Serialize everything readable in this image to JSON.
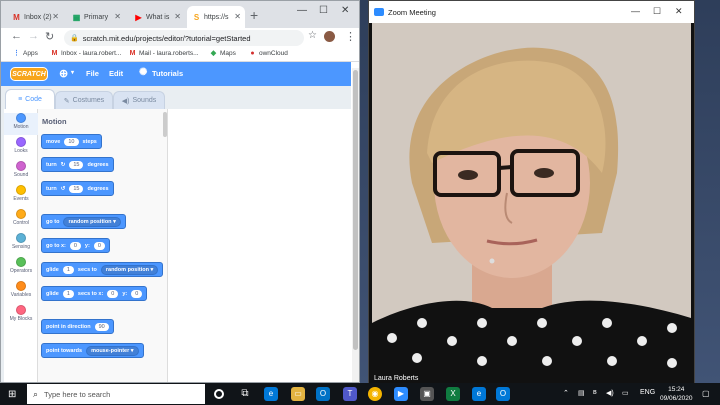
{
  "chrome": {
    "tabs": [
      {
        "icon": "gmail-icon",
        "glyph": "M",
        "color": "#d93025",
        "label": "Inbox (2)"
      },
      {
        "icon": "sheets-icon",
        "glyph": "▦",
        "color": "#0f9d58",
        "label": "Primary"
      },
      {
        "icon": "youtube-icon",
        "glyph": "▶",
        "color": "#ff0000",
        "label": "What is"
      },
      {
        "icon": "scratch-tab-icon",
        "glyph": "S",
        "color": "#f7a51c",
        "label": "https://s"
      }
    ],
    "new_tab": "+",
    "url": "scratch.mit.edu/projects/editor/?tutorial=getStarted",
    "bookmarks": [
      {
        "icon": "apps-icon",
        "glyph": "⋮",
        "color": "#4285f4",
        "label": "Apps"
      },
      {
        "icon": "gmail-icon",
        "glyph": "M",
        "color": "#d93025",
        "label": "Inbox - laura.robert..."
      },
      {
        "icon": "gmail-icon",
        "glyph": "M",
        "color": "#d93025",
        "label": "Mail - laura.roberts..."
      },
      {
        "icon": "maps-icon",
        "glyph": "◆",
        "color": "#34a853",
        "label": "Maps"
      },
      {
        "icon": "owncloud-icon",
        "glyph": "●",
        "color": "#d32f2f",
        "label": "ownCloud"
      }
    ]
  },
  "scratch": {
    "logo": "SCRATCH",
    "menu": {
      "file": "File",
      "edit": "Edit",
      "tutorials": "Tutorials"
    },
    "tabs": {
      "code": "Code",
      "costumes": "Costumes",
      "sounds": "Sounds"
    },
    "categories": [
      {
        "label": "Motion",
        "color": "#4c97ff"
      },
      {
        "label": "Looks",
        "color": "#9966ff"
      },
      {
        "label": "Sound",
        "color": "#cf63cf"
      },
      {
        "label": "Events",
        "color": "#ffbf00"
      },
      {
        "label": "Control",
        "color": "#ffab19"
      },
      {
        "label": "Sensing",
        "color": "#5cb1d6"
      },
      {
        "label": "Operators",
        "color": "#59c059"
      },
      {
        "label": "Variables",
        "color": "#ff8c1a"
      },
      {
        "label": "My Blocks",
        "color": "#ff6680"
      }
    ],
    "palette_title": "Motion",
    "blocks": {
      "move": {
        "a": "move",
        "n": "10",
        "b": "steps"
      },
      "turn_right": {
        "a": "turn",
        "n": "15",
        "b": "degrees"
      },
      "turn_left": {
        "a": "turn",
        "n": "15",
        "b": "degrees"
      },
      "goto": {
        "a": "go to",
        "dd": "random position ▾"
      },
      "gotoxy": {
        "a": "go to x:",
        "x": "0",
        "y_label": "y:",
        "y": "0"
      },
      "glide_to": {
        "a": "glide",
        "n": "1",
        "b": "secs to",
        "dd": "random position ▾"
      },
      "glide_xy": {
        "a": "glide",
        "n": "1",
        "b": "secs to x:",
        "x": "0",
        "y_label": "y:",
        "y": "0"
      },
      "point_dir": {
        "a": "point in direction",
        "n": "90"
      },
      "point_towards": {
        "a": "point towards",
        "dd": "mouse-pointer ▾"
      }
    }
  },
  "zoom": {
    "title": "Zoom Meeting",
    "participant": "Laura Roberts"
  },
  "taskbar": {
    "search_placeholder": "Type here to search",
    "language": "ENG",
    "time": "15:24",
    "date": "09/06/2020"
  }
}
